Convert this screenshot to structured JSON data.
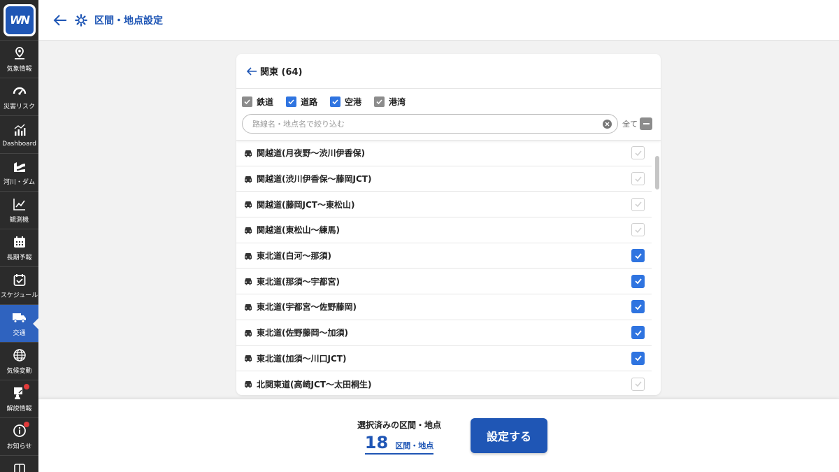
{
  "logo_text": "WN",
  "sidebar": {
    "items": [
      {
        "label": "気象情報",
        "icon": "map-pin-icon"
      },
      {
        "label": "災害リスク",
        "icon": "gauge-icon"
      },
      {
        "label": "Dashboard",
        "icon": "chart-icon"
      },
      {
        "label": "河川・ダム",
        "icon": "river-icon"
      },
      {
        "label": "観測機",
        "icon": "line-chart-icon"
      },
      {
        "label": "長期予報",
        "icon": "calendar-icon"
      },
      {
        "label": "スケジュール",
        "icon": "calendar-check-icon"
      },
      {
        "label": "交通",
        "icon": "truck-icon",
        "active": true
      },
      {
        "label": "気候変動",
        "icon": "globe-icon"
      },
      {
        "label": "解説情報",
        "icon": "presenter-icon"
      },
      {
        "label": "お知らせ",
        "icon": "info-icon"
      }
    ]
  },
  "header": {
    "title": "区間・地点設定"
  },
  "panel": {
    "title": "関東 (64)",
    "categories": [
      {
        "label": "鉄道",
        "state": "gray"
      },
      {
        "label": "道路",
        "state": "checked"
      },
      {
        "label": "空港",
        "state": "checked"
      },
      {
        "label": "港湾",
        "state": "gray"
      }
    ],
    "search": {
      "placeholder": "路線名・地点名で絞り込む",
      "value": ""
    },
    "select_all_label": "全て",
    "rows": [
      {
        "label": "関越道(月夜野〜渋川伊香保)",
        "checked": false
      },
      {
        "label": "関越道(渋川伊香保〜藤岡JCT)",
        "checked": false
      },
      {
        "label": "関越道(藤岡JCT〜東松山)",
        "checked": false
      },
      {
        "label": "関越道(東松山〜練馬)",
        "checked": false
      },
      {
        "label": "東北道(白河〜那須)",
        "checked": true
      },
      {
        "label": "東北道(那須〜宇都宮)",
        "checked": true
      },
      {
        "label": "東北道(宇都宮〜佐野藤岡)",
        "checked": true
      },
      {
        "label": "東北道(佐野藤岡〜加須)",
        "checked": true
      },
      {
        "label": "東北道(加須〜川口JCT)",
        "checked": true
      },
      {
        "label": "北関東道(高崎JCT〜太田桐生)",
        "checked": false
      }
    ]
  },
  "footer": {
    "selected_label": "選択済みの区間・地点",
    "selected_count": "18",
    "selected_unit": "区間・地点",
    "submit_label": "設定する"
  },
  "colors": {
    "accent": "#1f56b5",
    "active_nav": "#2f63bf",
    "check_blue": "#2f74e0",
    "sidebar_bg": "#2b2b2b"
  }
}
